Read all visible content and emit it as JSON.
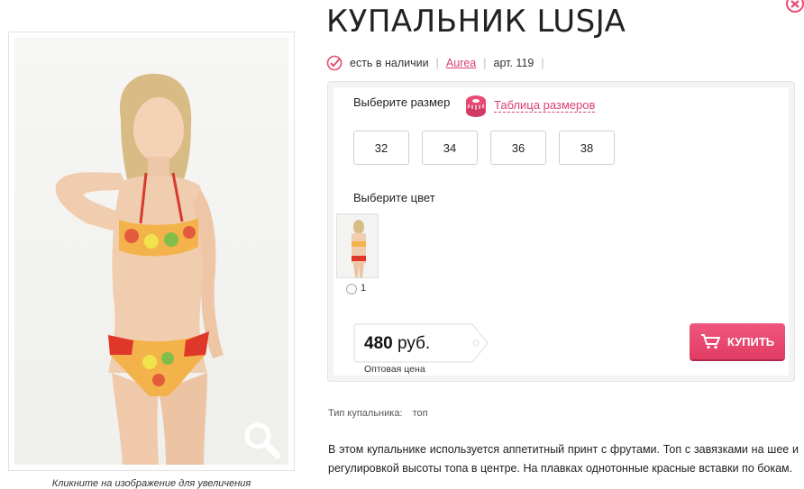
{
  "product": {
    "title": "КУПАЛЬНИК LUSJA",
    "availability": "есть в наличии",
    "brand": "Aurea",
    "article": "арт. 119"
  },
  "photo": {
    "caption": "Кликните на изображение для увеличения"
  },
  "selection": {
    "size_label": "Выберите размер",
    "size_table_link": "Таблица размеров",
    "sizes": [
      "32",
      "34",
      "36",
      "38"
    ],
    "color_label": "Выберите цвет",
    "color_option_label": "1"
  },
  "price": {
    "value": "480",
    "currency": "руб.",
    "note": "Оптовая цена"
  },
  "buy_button": {
    "label": "КУПИТЬ"
  },
  "attributes": {
    "type_label": "Тип купальника:",
    "type_value": "топ"
  },
  "description": "В этом купальнике используется аппетитный принт с фрутами. Топ с завязками на шее и регулировкой высоты топа в центре. На плавках однотонные красные вставки по бокам.",
  "colors": {
    "accent": "#d9416f",
    "buy_button": "#e84b72"
  },
  "icons": {
    "stock": "check-circle-icon",
    "close": "close-icon",
    "size_table": "measuring-tape-icon",
    "zoom": "magnifier-icon",
    "cart": "cart-icon"
  }
}
